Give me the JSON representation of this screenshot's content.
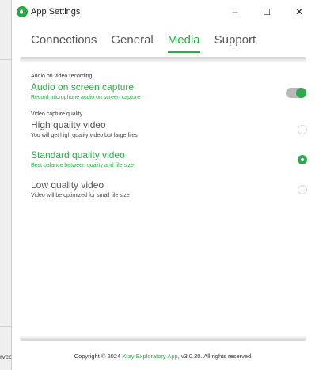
{
  "window": {
    "title": "App Settings",
    "minimize": "–",
    "maximize": "☐",
    "close": "✕"
  },
  "background": {
    "clipped_text": "rvec"
  },
  "tabs": [
    {
      "label": "Connections",
      "active": false
    },
    {
      "label": "General",
      "active": false
    },
    {
      "label": "Media",
      "active": true
    },
    {
      "label": "Support",
      "active": false
    }
  ],
  "media": {
    "audio_section_label": "Audio on video recording",
    "audio_title": "Audio on screen capture",
    "audio_desc": "Record microphone audio on screen capture",
    "audio_enabled": true,
    "video_section_label": "Video capture quality",
    "options": [
      {
        "title": "High quality video",
        "desc": "You will get high quality video but large files",
        "selected": false
      },
      {
        "title": "Standard quality video",
        "desc": "Best balance between quality and file size",
        "selected": true
      },
      {
        "title": "Low quality video",
        "desc": "Video will be optimized for small file size",
        "selected": false
      }
    ]
  },
  "footer": {
    "prefix": "Copyright © 2024 ",
    "link": "Xray Exploratory App",
    "suffix": ", v3.0.20. All rights reserved."
  },
  "colors": {
    "accent": "#2eaa4a",
    "toggle_track": "#b9b9b9"
  }
}
